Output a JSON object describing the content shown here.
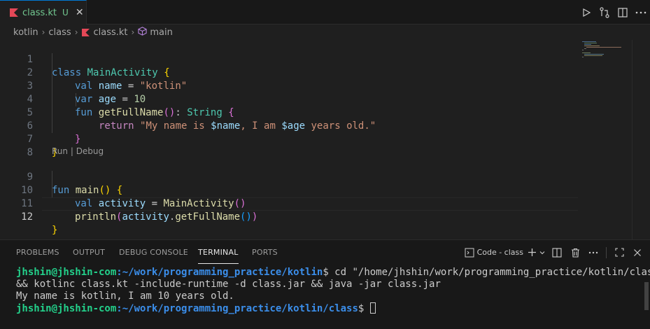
{
  "tab": {
    "filename": "class.kt",
    "status": "U",
    "close": "✕"
  },
  "breadcrumb": [
    "kotlin",
    "class",
    "class.kt",
    "main"
  ],
  "editor": {
    "line_numbers": [
      "1",
      "2",
      "3",
      "4",
      "5",
      "6",
      "7",
      "8",
      "9",
      "10",
      "11",
      "12"
    ],
    "active_line": "12",
    "codelens": {
      "run": "Run",
      "sep": " | ",
      "debug": "Debug"
    },
    "code": {
      "l1": [
        "class",
        " ",
        "MainActivity",
        " ",
        "{"
      ],
      "l2": [
        "val",
        " ",
        "name",
        " = ",
        "\"kotlin\""
      ],
      "l3": [
        "var",
        " ",
        "age",
        " = ",
        "10"
      ],
      "l4": [
        "fun",
        " ",
        "getFullName",
        "(",
        ")",
        ": ",
        "String",
        " ",
        "{"
      ],
      "l5": [
        "return",
        " ",
        "\"My name is ",
        "$name",
        ", I am ",
        "$age",
        " years old.\""
      ],
      "l6": [
        "}"
      ],
      "l7": [
        "}"
      ],
      "l9": [
        "fun",
        " ",
        "main",
        "(",
        ")",
        " ",
        "{"
      ],
      "l10": [
        "val",
        " ",
        "activity",
        " = ",
        "MainActivity",
        "(",
        ")"
      ],
      "l11": [
        "println",
        "(",
        "activity",
        ".",
        "getFullName",
        "(",
        ")",
        ")"
      ],
      "l12": [
        "}"
      ]
    }
  },
  "panel": {
    "tabs": [
      "PROBLEMS",
      "OUTPUT",
      "DEBUG CONSOLE",
      "TERMINAL",
      "PORTS"
    ],
    "active_tab": "TERMINAL",
    "terminal_name": "Code - class",
    "terminal": {
      "user1": "jhshin@jhshin-com",
      "path1": ":~/work/programming_practice/kotlin",
      "cmd1": "$ cd \"/home/jhshin/work/programming_practice/kotlin/class/\"",
      "cmd1b": "&& kotlinc class.kt -include-runtime -d class.jar && java -jar class.jar",
      "output": "My name is kotlin, I am 10 years old.",
      "user2": "jhshin@jhshin-com",
      "path2": ":~/work/programming_practice/kotlin/class",
      "prompt2": "$ "
    }
  },
  "colors": {
    "accent": "#0078d4",
    "untracked": "#73c991",
    "keyword": "#569cd6",
    "type": "#4ec9b0",
    "variable": "#9cdcfe",
    "string": "#ce9178",
    "number": "#b5cea8",
    "function": "#dcdcaa",
    "terminal_user": "#23d18b",
    "terminal_path": "#3b8eea"
  }
}
